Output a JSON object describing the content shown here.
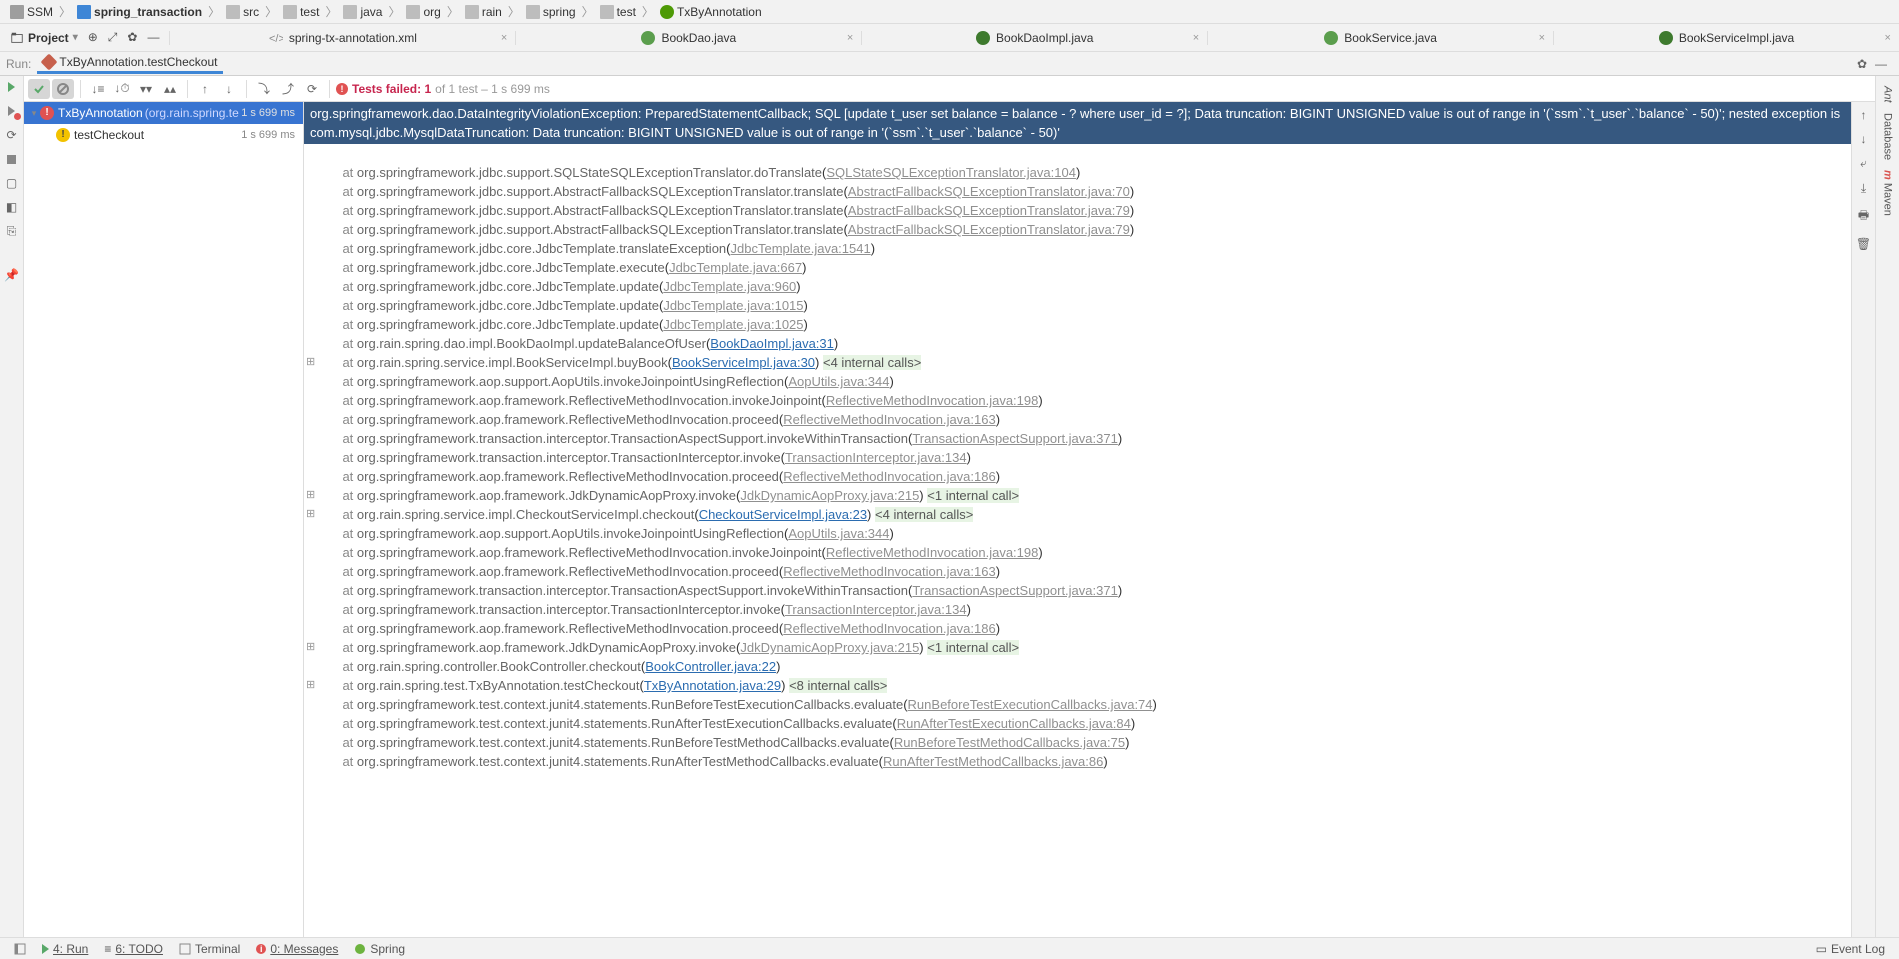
{
  "breadcrumbs": [
    "SSM",
    "spring_transaction",
    "src",
    "test",
    "java",
    "org",
    "rain",
    "spring",
    "test",
    "TxByAnnotation"
  ],
  "project_label": "Project",
  "editor_tabs": [
    {
      "label": "spring-tx-annotation.xml",
      "type": "xml"
    },
    {
      "label": "BookDao.java",
      "type": "interface"
    },
    {
      "label": "BookDaoImpl.java",
      "type": "class"
    },
    {
      "label": "BookService.java",
      "type": "interface"
    },
    {
      "label": "BookServiceImpl.java",
      "type": "class"
    }
  ],
  "run_label": "Run:",
  "run_config": "TxByAnnotation.testCheckout",
  "tests_failed_label": "Tests failed: 1",
  "tests_failed_suffix": " of 1 test – 1 s 699 ms",
  "tree": {
    "root": {
      "name": "TxByAnnotation",
      "pkg": "(org.rain.spring.te",
      "time": "1 s 699 ms"
    },
    "child": {
      "name": "testCheckout",
      "time": "1 s 699 ms"
    }
  },
  "exception_header": "org.springframework.dao.DataIntegrityViolationException: PreparedStatementCallback; SQL [update t_user set balance = balance - ? where user_id = ?]; Data truncation: BIGINT UNSIGNED value is out of range in '(`ssm`.`t_user`.`balance` - 50)'; nested exception is com.mysql.jdbc.MysqlDataTruncation: Data truncation: BIGINT UNSIGNED value is out of range in '(`ssm`.`t_user`.`balance` - 50)'",
  "stack": [
    {
      "cls": "org.springframework.jdbc.support.SQLStateSQLExceptionTranslator.doTranslate",
      "link": "SQLStateSQLExceptionTranslator.java:104",
      "lt": "g"
    },
    {
      "cls": "org.springframework.jdbc.support.AbstractFallbackSQLExceptionTranslator.translate",
      "link": "AbstractFallbackSQLExceptionTranslator.java:70",
      "lt": "g"
    },
    {
      "cls": "org.springframework.jdbc.support.AbstractFallbackSQLExceptionTranslator.translate",
      "link": "AbstractFallbackSQLExceptionTranslator.java:79",
      "lt": "g"
    },
    {
      "cls": "org.springframework.jdbc.support.AbstractFallbackSQLExceptionTranslator.translate",
      "link": "AbstractFallbackSQLExceptionTranslator.java:79",
      "lt": "g"
    },
    {
      "cls": "org.springframework.jdbc.core.JdbcTemplate.translateException",
      "link": "JdbcTemplate.java:1541",
      "lt": "g"
    },
    {
      "cls": "org.springframework.jdbc.core.JdbcTemplate.execute",
      "link": "JdbcTemplate.java:667",
      "lt": "g"
    },
    {
      "cls": "org.springframework.jdbc.core.JdbcTemplate.update",
      "link": "JdbcTemplate.java:960",
      "lt": "g"
    },
    {
      "cls": "org.springframework.jdbc.core.JdbcTemplate.update",
      "link": "JdbcTemplate.java:1015",
      "lt": "g"
    },
    {
      "cls": "org.springframework.jdbc.core.JdbcTemplate.update",
      "link": "JdbcTemplate.java:1025",
      "lt": "g"
    },
    {
      "cls": "org.rain.spring.dao.impl.BookDaoImpl.updateBalanceOfUser",
      "link": "BookDaoImpl.java:31",
      "lt": "b"
    },
    {
      "cls": "org.rain.spring.service.impl.BookServiceImpl.buyBook",
      "link": "BookServiceImpl.java:30",
      "lt": "b",
      "extra": "<4 internal calls>",
      "fold": true
    },
    {
      "cls": "org.springframework.aop.support.AopUtils.invokeJoinpointUsingReflection",
      "link": "AopUtils.java:344",
      "lt": "g"
    },
    {
      "cls": "org.springframework.aop.framework.ReflectiveMethodInvocation.invokeJoinpoint",
      "link": "ReflectiveMethodInvocation.java:198",
      "lt": "g"
    },
    {
      "cls": "org.springframework.aop.framework.ReflectiveMethodInvocation.proceed",
      "link": "ReflectiveMethodInvocation.java:163",
      "lt": "g"
    },
    {
      "cls": "org.springframework.transaction.interceptor.TransactionAspectSupport.invokeWithinTransaction",
      "link": "TransactionAspectSupport.java:371",
      "lt": "g"
    },
    {
      "cls": "org.springframework.transaction.interceptor.TransactionInterceptor.invoke",
      "link": "TransactionInterceptor.java:134",
      "lt": "g"
    },
    {
      "cls": "org.springframework.aop.framework.ReflectiveMethodInvocation.proceed",
      "link": "ReflectiveMethodInvocation.java:186",
      "lt": "g"
    },
    {
      "cls": "org.springframework.aop.framework.JdkDynamicAopProxy.invoke",
      "link": "JdkDynamicAopProxy.java:215",
      "lt": "g",
      "extra": "<1 internal call>",
      "fold": true
    },
    {
      "cls": "org.rain.spring.service.impl.CheckoutServiceImpl.checkout",
      "link": "CheckoutServiceImpl.java:23",
      "lt": "b",
      "extra": "<4 internal calls>",
      "fold": true
    },
    {
      "cls": "org.springframework.aop.support.AopUtils.invokeJoinpointUsingReflection",
      "link": "AopUtils.java:344",
      "lt": "g"
    },
    {
      "cls": "org.springframework.aop.framework.ReflectiveMethodInvocation.invokeJoinpoint",
      "link": "ReflectiveMethodInvocation.java:198",
      "lt": "g"
    },
    {
      "cls": "org.springframework.aop.framework.ReflectiveMethodInvocation.proceed",
      "link": "ReflectiveMethodInvocation.java:163",
      "lt": "g"
    },
    {
      "cls": "org.springframework.transaction.interceptor.TransactionAspectSupport.invokeWithinTransaction",
      "link": "TransactionAspectSupport.java:371",
      "lt": "g"
    },
    {
      "cls": "org.springframework.transaction.interceptor.TransactionInterceptor.invoke",
      "link": "TransactionInterceptor.java:134",
      "lt": "g"
    },
    {
      "cls": "org.springframework.aop.framework.ReflectiveMethodInvocation.proceed",
      "link": "ReflectiveMethodInvocation.java:186",
      "lt": "g"
    },
    {
      "cls": "org.springframework.aop.framework.JdkDynamicAopProxy.invoke",
      "link": "JdkDynamicAopProxy.java:215",
      "lt": "g",
      "extra": "<1 internal call>",
      "fold": true
    },
    {
      "cls": "org.rain.spring.controller.BookController.checkout",
      "link": "BookController.java:22",
      "lt": "b"
    },
    {
      "cls": "org.rain.spring.test.TxByAnnotation.testCheckout",
      "link": "TxByAnnotation.java:29",
      "lt": "b",
      "extra": "<8 internal calls>",
      "fold": true
    },
    {
      "cls": "org.springframework.test.context.junit4.statements.RunBeforeTestExecutionCallbacks.evaluate",
      "link": "RunBeforeTestExecutionCallbacks.java:74",
      "lt": "g"
    },
    {
      "cls": "org.springframework.test.context.junit4.statements.RunAfterTestExecutionCallbacks.evaluate",
      "link": "RunAfterTestExecutionCallbacks.java:84",
      "lt": "g"
    },
    {
      "cls": "org.springframework.test.context.junit4.statements.RunBeforeTestMethodCallbacks.evaluate",
      "link": "RunBeforeTestMethodCallbacks.java:75",
      "lt": "g"
    },
    {
      "cls": "org.springframework.test.context.junit4.statements.RunAfterTestMethodCallbacks.evaluate",
      "link": "RunAfterTestMethodCallbacks.java:86",
      "lt": "g"
    }
  ],
  "status": {
    "run": "4: Run",
    "todo": "6: TODO",
    "terminal": "Terminal",
    "messages": "0: Messages",
    "spring": "Spring",
    "event_log": "Event Log"
  },
  "right_rail": [
    "Ant",
    "Database",
    "Maven"
  ]
}
